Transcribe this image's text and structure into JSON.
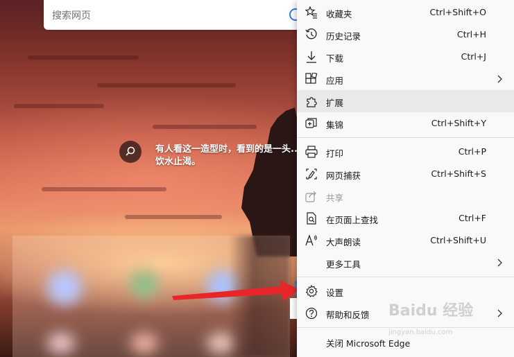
{
  "search": {
    "placeholder": "搜索网页"
  },
  "caption": {
    "text": "有人看这一造型时，看到的是一头...饮水止渴。"
  },
  "menu": {
    "items": [
      {
        "label": "收藏夹",
        "shortcut": "Ctrl+Shift+O",
        "icon": "star-list-icon"
      },
      {
        "label": "历史记录",
        "shortcut": "Ctrl+H",
        "icon": "history-icon"
      },
      {
        "label": "下载",
        "shortcut": "Ctrl+J",
        "icon": "download-icon"
      },
      {
        "label": "应用",
        "shortcut": "",
        "icon": "apps-icon",
        "submenu": true
      },
      {
        "label": "扩展",
        "shortcut": "",
        "icon": "extensions-icon",
        "hover": true
      },
      {
        "label": "集锦",
        "shortcut": "Ctrl+Shift+Y",
        "icon": "collections-icon"
      },
      {
        "label": "打印",
        "shortcut": "Ctrl+P",
        "icon": "print-icon"
      },
      {
        "label": "网页捕获",
        "shortcut": "Ctrl+Shift+S",
        "icon": "web-capture-icon"
      },
      {
        "label": "共享",
        "shortcut": "",
        "icon": "share-icon",
        "disabled": true
      },
      {
        "label": "在页面上查找",
        "shortcut": "Ctrl+F",
        "icon": "find-icon"
      },
      {
        "label": "大声朗读",
        "shortcut": "Ctrl+Shift+U",
        "icon": "read-aloud-icon"
      },
      {
        "label": "更多工具",
        "shortcut": "",
        "icon": "",
        "submenu": true
      },
      {
        "label": "设置",
        "shortcut": "",
        "icon": "gear-icon"
      },
      {
        "label": "帮助和反馈",
        "shortcut": "",
        "icon": "help-icon",
        "submenu": true
      },
      {
        "label": "关闭 Microsoft Edge",
        "shortcut": "",
        "icon": ""
      }
    ]
  },
  "watermark": {
    "text": "Baidu 经验",
    "sub": "jingyan.baidu.com"
  },
  "colors": {
    "accent": "#2b7de9",
    "arrow": "#e8262a"
  }
}
